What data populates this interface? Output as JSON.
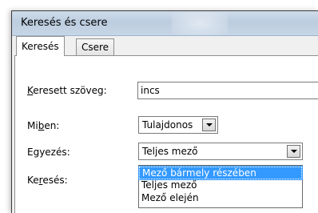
{
  "window": {
    "title": "Keresés és csere"
  },
  "tabs": [
    {
      "label": "Keresés",
      "active": true
    },
    {
      "label": "Csere",
      "active": false
    }
  ],
  "fields": {
    "search_text": {
      "label_pre": "",
      "label_key": "K",
      "label_post": "eresett szöveg:",
      "value": "incs"
    },
    "look_in": {
      "label_pre": "Mi",
      "label_key": "b",
      "label_post": "en:",
      "value": "Tulajdonos"
    },
    "match": {
      "label": "Egyezés:",
      "value": "Teljes mező"
    },
    "search_dir": {
      "label_pre": "Ke",
      "label_key": "r",
      "label_post": "esés:"
    }
  },
  "match_options": [
    "Mező bármely részében",
    "Teljes mező",
    "Mező elején"
  ],
  "selected_option_index": 0,
  "colors": {
    "selection": "#3399ff",
    "titlebar": "#c5d4e5"
  },
  "icons": [
    "chevron-down-icon"
  ]
}
